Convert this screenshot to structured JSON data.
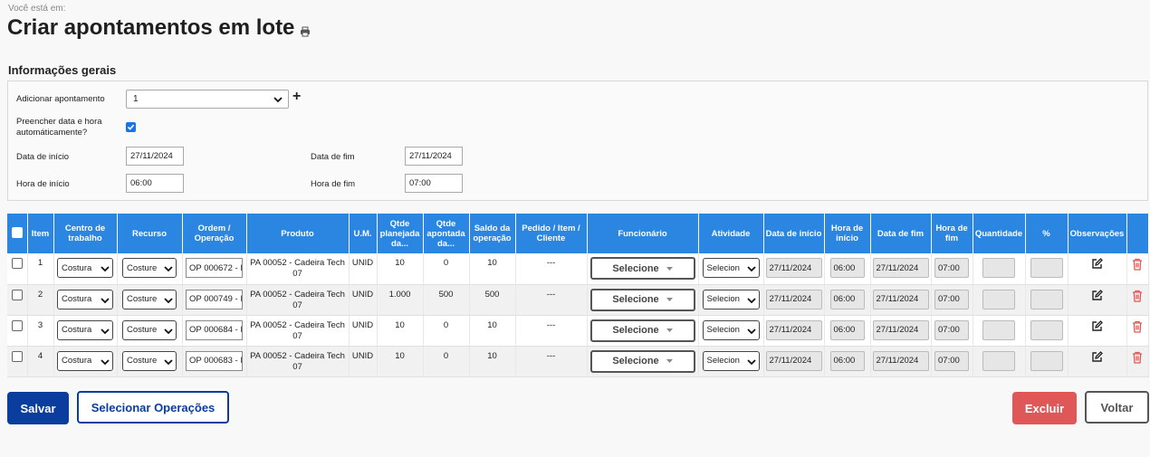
{
  "breadcrumb": "Você está em:",
  "page_title": "Criar apontamentos em lote",
  "section_title": "Informações gerais",
  "form": {
    "add_label": "Adicionar apontamento",
    "add_value": "1",
    "autofill_label_1": "Preencher data e hora",
    "autofill_label_2": "automáticamente?",
    "autofill_checked": true,
    "start_date_label": "Data de início",
    "start_date_value": "27/11/2024",
    "end_date_label": "Data de fim",
    "end_date_value": "27/11/2024",
    "start_time_label": "Hora de início",
    "start_time_value": "06:00",
    "end_time_label": "Hora de fim",
    "end_time_value": "07:00"
  },
  "table": {
    "headers": {
      "item": "Item",
      "centro": "Centro de trabalho",
      "recurso": "Recurso",
      "ordem": "Ordem / Operação",
      "produto": "Produto",
      "um": "U.M.",
      "qtde_plan": "Qtde planejada da...",
      "qtde_apont": "Qtde apontada da...",
      "saldo": "Saldo da operação",
      "pedido": "Pedido / Item / Cliente",
      "funcionario": "Funcionário",
      "atividade": "Atividade",
      "data_inicio": "Data de início",
      "hora_inicio": "Hora de início",
      "data_fim": "Data de fim",
      "hora_fim": "Hora de fim",
      "quantidade": "Quantidade",
      "pct": "%",
      "obs": "Observações"
    },
    "rows": [
      {
        "item": "1",
        "centro": "Costura",
        "recurso": "Costure",
        "ordem": "OP 000672 - I",
        "produto": "PA 00052 - Cadeira Tech 07",
        "um": "UNID",
        "qtde_plan": "10",
        "qtde_apont": "0",
        "saldo": "10",
        "pedido": "---",
        "funcionario": "Selecione",
        "atividade": "Selecion",
        "data_inicio": "27/11/2024",
        "hora_inicio": "06:00",
        "data_fim": "27/11/2024",
        "hora_fim": "07:00"
      },
      {
        "item": "2",
        "centro": "Costura",
        "recurso": "Costure",
        "ordem": "OP 000749 - I",
        "produto": "PA 00052 - Cadeira Tech 07",
        "um": "UNID",
        "qtde_plan": "1.000",
        "qtde_apont": "500",
        "saldo": "500",
        "pedido": "---",
        "funcionario": "Selecione",
        "atividade": "Selecion",
        "data_inicio": "27/11/2024",
        "hora_inicio": "06:00",
        "data_fim": "27/11/2024",
        "hora_fim": "07:00"
      },
      {
        "item": "3",
        "centro": "Costura",
        "recurso": "Costure",
        "ordem": "OP 000684 - I",
        "produto": "PA 00052 - Cadeira Tech 07",
        "um": "UNID",
        "qtde_plan": "10",
        "qtde_apont": "0",
        "saldo": "10",
        "pedido": "---",
        "funcionario": "Selecione",
        "atividade": "Selecion",
        "data_inicio": "27/11/2024",
        "hora_inicio": "06:00",
        "data_fim": "27/11/2024",
        "hora_fim": "07:00"
      },
      {
        "item": "4",
        "centro": "Costura",
        "recurso": "Costure",
        "ordem": "OP 000683 - I",
        "produto": "PA 00052 - Cadeira Tech 07",
        "um": "UNID",
        "qtde_plan": "10",
        "qtde_apont": "0",
        "saldo": "10",
        "pedido": "---",
        "funcionario": "Selecione",
        "atividade": "Selecion",
        "data_inicio": "27/11/2024",
        "hora_inicio": "06:00",
        "data_fim": "27/11/2024",
        "hora_fim": "07:00"
      }
    ]
  },
  "buttons": {
    "save": "Salvar",
    "select_ops": "Selecionar Operações",
    "delete": "Excluir",
    "back": "Voltar"
  },
  "colors": {
    "header_blue": "#2a86e0",
    "primary": "#0a3d9e",
    "danger": "#e05757",
    "trash": "#e05757"
  }
}
